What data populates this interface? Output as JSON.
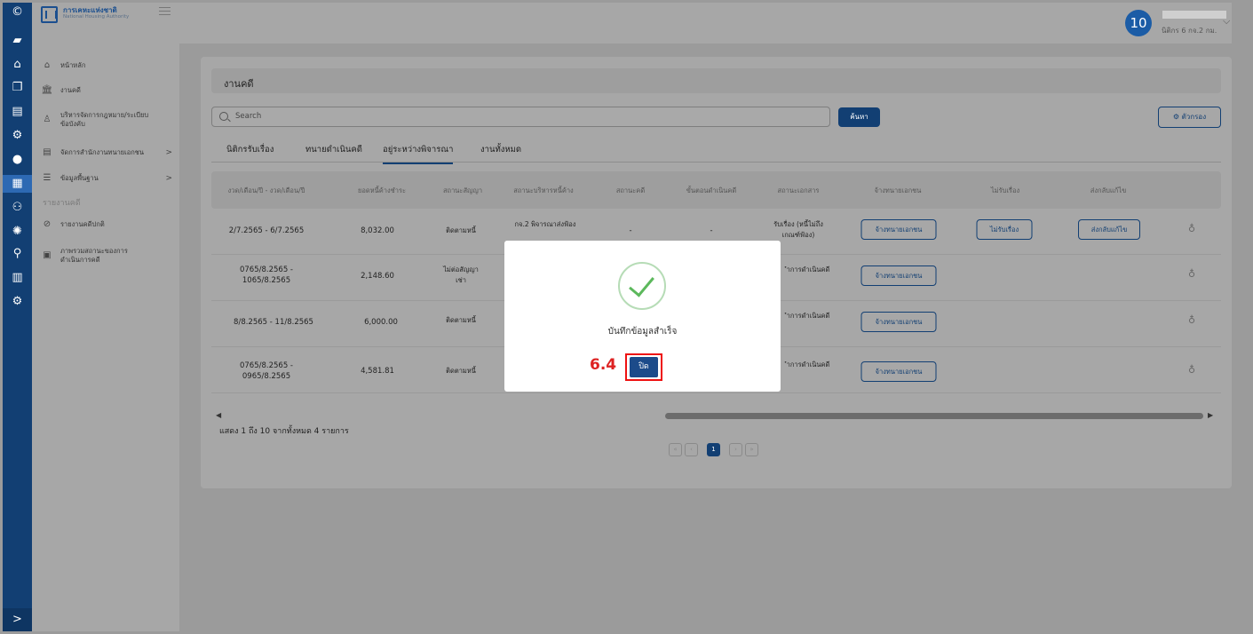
{
  "rail": {
    "icons": [
      "logo-icon",
      "graduation-cap-icon",
      "home-icon",
      "copy-icon",
      "file-icon",
      "gear-icon",
      "user-icon",
      "dashboard-icon",
      "users-icon",
      "settings-icon",
      "search-icon",
      "bar-chart-icon",
      "cogs-icon"
    ],
    "expand_label": ">"
  },
  "sidebar": {
    "logo_th": "การเคหะแห่งชาติ",
    "logo_en": "National Housing Authority",
    "items": [
      {
        "label": "หน้าหลัก",
        "icon": "home-icon",
        "glyph": "⌂"
      },
      {
        "label": "งานคดี",
        "icon": "bank-icon",
        "glyph": "🏛"
      },
      {
        "label": "บริหารจัดการกฎหมาย/ระเบียบ ข้อบังคับ",
        "icon": "chess-icon",
        "glyph": "♙"
      },
      {
        "label": "จัดการสำนักงานทนายเอกชน",
        "icon": "clipboard-icon",
        "glyph": "▤",
        "chevron": ">"
      },
      {
        "label": "ข้อมูลพื้นฐาน",
        "icon": "list-icon",
        "glyph": "☰",
        "chevron": ">"
      }
    ],
    "section_label": "รายงานคดี",
    "report_items": [
      {
        "label": "รายงานคดีปกติ",
        "icon": "ban-icon",
        "glyph": "⊘"
      },
      {
        "label": "ภาพรวมสถานะของการ ดำเนินการคดี",
        "icon": "document-icon",
        "glyph": "▣"
      }
    ]
  },
  "header": {
    "avatar_text": "10",
    "user_role": "นิติกร 6 กจ.2 กม.",
    "chevron": "⌵"
  },
  "page": {
    "title": "งานคดี",
    "search_placeholder": "Search",
    "search_button": "ค้นหา",
    "filter_button": "⚙ ตัวกรอง",
    "tabs": [
      "นิติกรรับเรื่อง",
      "ทนายดำเนินคดี",
      "อยู่ระหว่างพิจารณา",
      "งานทั้งหมด"
    ],
    "active_tab": 2
  },
  "table": {
    "headers": [
      "งวด/เดือน/ปี - งวด/เดือน/ปี",
      "ยอดหนี้ค้างชำระ",
      "สถานะสัญญา",
      "สถานะบริหารหนี้ค้าง",
      "สถานะคดี",
      "ขั้นตอนดำเนินคดี",
      "สถานะเอกสาร",
      "จ้างทนายเอกชน",
      "ไม่รับเรื่อง",
      "ส่งกลับแก้ไข"
    ],
    "rows": [
      {
        "period": "2/7.2565 - 6/7.2565",
        "amount": "8,032.00",
        "contract": "ติดตามหนี้",
        "debt_status": "กจ.2 พิจารณาส่งฟ้อง",
        "case_status": "-",
        "step": "-",
        "doc_status": "รับเรื่อง (หนี้ไม่ถึงเกณฑ์ฟ้อง)",
        "btn_hire": "จ้างทนายเอกชน",
        "btn_reject": "ไม่รับเรื่อง",
        "btn_return": "ส่งกลับแก้ไข"
      },
      {
        "period": "0765/8.2565 - 1065/8.2565",
        "amount": "2,148.60",
        "contract": "ไม่ต่อสัญญาเช่า",
        "doc_status": "ำการดำเนินคดี",
        "btn_hire": "จ้างทนายเอกชน"
      },
      {
        "period": "8/8.2565 - 11/8.2565",
        "amount": "6,000.00",
        "contract": "ติดตามหนี้",
        "doc_status": "ำการดำเนินคดี",
        "btn_hire": "จ้างทนายเอกชน"
      },
      {
        "period": "0765/8.2565 - 0965/8.2565",
        "amount": "4,581.81",
        "contract": "ติดตามหนี้",
        "doc_status": "ำการดำเนินคดี",
        "btn_hire": "จ้างทนายเอกชน"
      }
    ],
    "showing_text": "แสดง 1 ถึง 10 จากทั้งหมด 4 รายการ",
    "current_page": "1"
  },
  "modal": {
    "message": "บันทึกข้อมูลสำเร็จ",
    "close_button": "ปิด",
    "step_label": "6.4"
  }
}
